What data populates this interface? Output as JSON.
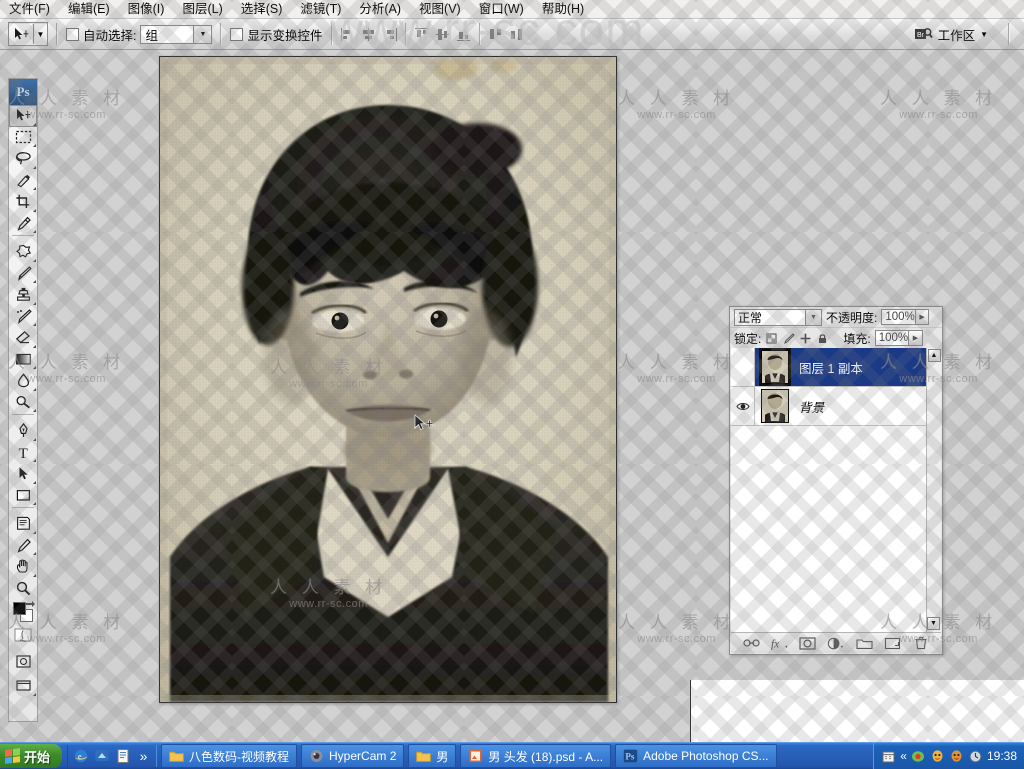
{
  "app": {
    "name": "Adobe Photoshop CS",
    "logo_text": "Ps"
  },
  "menubar": {
    "items": [
      {
        "label": "文件(F)",
        "name": "menu-file"
      },
      {
        "label": "编辑(E)",
        "name": "menu-edit"
      },
      {
        "label": "图像(I)",
        "name": "menu-image"
      },
      {
        "label": "图层(L)",
        "name": "menu-layer"
      },
      {
        "label": "选择(S)",
        "name": "menu-select"
      },
      {
        "label": "滤镜(T)",
        "name": "menu-filter"
      },
      {
        "label": "分析(A)",
        "name": "menu-analysis"
      },
      {
        "label": "视图(V)",
        "name": "menu-view"
      },
      {
        "label": "窗口(W)",
        "name": "menu-window"
      },
      {
        "label": "帮助(H)",
        "name": "menu-help"
      }
    ]
  },
  "options_bar": {
    "active_tool": "move-tool",
    "auto_select_label": "自动选择:",
    "auto_select_checked": false,
    "auto_select_value": "组",
    "show_transform_label": "显示变换控件",
    "show_transform_checked": false,
    "workspace_label": "工作区",
    "bridge_icon": "bridge-icon"
  },
  "toolbox": {
    "tools": [
      {
        "name": "move-tool",
        "active": true
      },
      {
        "name": "marquee-tool",
        "active": false
      },
      {
        "name": "lasso-tool",
        "active": false
      },
      {
        "name": "quick-selection-tool",
        "active": false
      },
      {
        "name": "crop-tool",
        "active": false
      },
      {
        "name": "eyedropper-tool",
        "active": false
      },
      {
        "name": "healing-brush-tool",
        "active": false
      },
      {
        "name": "brush-tool",
        "active": false
      },
      {
        "name": "clone-stamp-tool",
        "active": false
      },
      {
        "name": "history-brush-tool",
        "active": false
      },
      {
        "name": "eraser-tool",
        "active": false
      },
      {
        "name": "gradient-tool",
        "active": false
      },
      {
        "name": "blur-tool",
        "active": false
      },
      {
        "name": "dodge-tool",
        "active": false
      },
      {
        "name": "pen-tool",
        "active": false
      },
      {
        "name": "type-tool",
        "active": false
      },
      {
        "name": "path-selection-tool",
        "active": false
      },
      {
        "name": "rectangle-shape-tool",
        "active": false
      },
      {
        "name": "notes-tool",
        "active": false
      },
      {
        "name": "eyedropper-alt-tool",
        "active": false
      },
      {
        "name": "hand-tool",
        "active": false
      },
      {
        "name": "zoom-tool",
        "active": false
      }
    ],
    "foreground_color": "#000000",
    "background_color": "#ffffff"
  },
  "document": {
    "title": "男 头发 (18).psd",
    "photo_alt": "黑白证件照 男青年"
  },
  "layers_panel": {
    "blend_mode": "正常",
    "opacity_label": "不透明度:",
    "opacity_value": "100%",
    "lock_label": "锁定:",
    "fill_label": "填充:",
    "fill_value": "100%",
    "lock_icons": [
      "lock-transparent-icon",
      "lock-image-icon",
      "lock-position-icon",
      "lock-all-icon"
    ],
    "layers": [
      {
        "name": "图层 1 副本",
        "selected": true,
        "visible": false,
        "locked": false,
        "italic": false
      },
      {
        "name": "背景",
        "selected": false,
        "visible": true,
        "locked": true,
        "italic": true
      }
    ],
    "footer_buttons": [
      {
        "name": "link-layers-button",
        "glyph": "link-icon"
      },
      {
        "name": "layer-style-button",
        "glyph": "fx-icon"
      },
      {
        "name": "layer-mask-button",
        "glyph": "mask-icon"
      },
      {
        "name": "adjustment-layer-button",
        "glyph": "adjustment-icon"
      },
      {
        "name": "new-group-button",
        "glyph": "folder-icon"
      },
      {
        "name": "new-layer-button",
        "glyph": "new-layer-icon"
      },
      {
        "name": "delete-layer-button",
        "glyph": "trash-icon"
      }
    ]
  },
  "taskbar": {
    "start_label": "开始",
    "quick_launch": [
      {
        "name": "ie-icon"
      },
      {
        "name": "show-desktop-icon"
      },
      {
        "name": "notepad-icon"
      },
      {
        "name": "more-chevron-icon",
        "label": "»"
      }
    ],
    "tasks": [
      {
        "label": "八色数码-视频教程",
        "icon": "folder-icon",
        "name": "taskbar-item-folder-tutorial"
      },
      {
        "label": "HyperCam 2",
        "icon": "hypercam-icon",
        "name": "taskbar-item-hypercam"
      },
      {
        "label": "男",
        "icon": "folder-icon",
        "name": "taskbar-item-folder-nan"
      },
      {
        "label": "男 头发 (18).psd - A...",
        "icon": "image-icon",
        "name": "taskbar-item-psd"
      },
      {
        "label": "Adobe Photoshop CS...",
        "icon": "ps-icon",
        "name": "taskbar-item-photoshop"
      }
    ],
    "tray_chevron": "«",
    "tray_icons": [
      "calendar-icon",
      "recorder-icon",
      "qq-icon",
      "qq2-icon",
      "clock-icon"
    ],
    "clock": "19:38"
  },
  "watermark": {
    "cn": "人 人 素 材",
    "en": "www.rr-sc.com",
    "big": "www.rr-sc.com"
  }
}
